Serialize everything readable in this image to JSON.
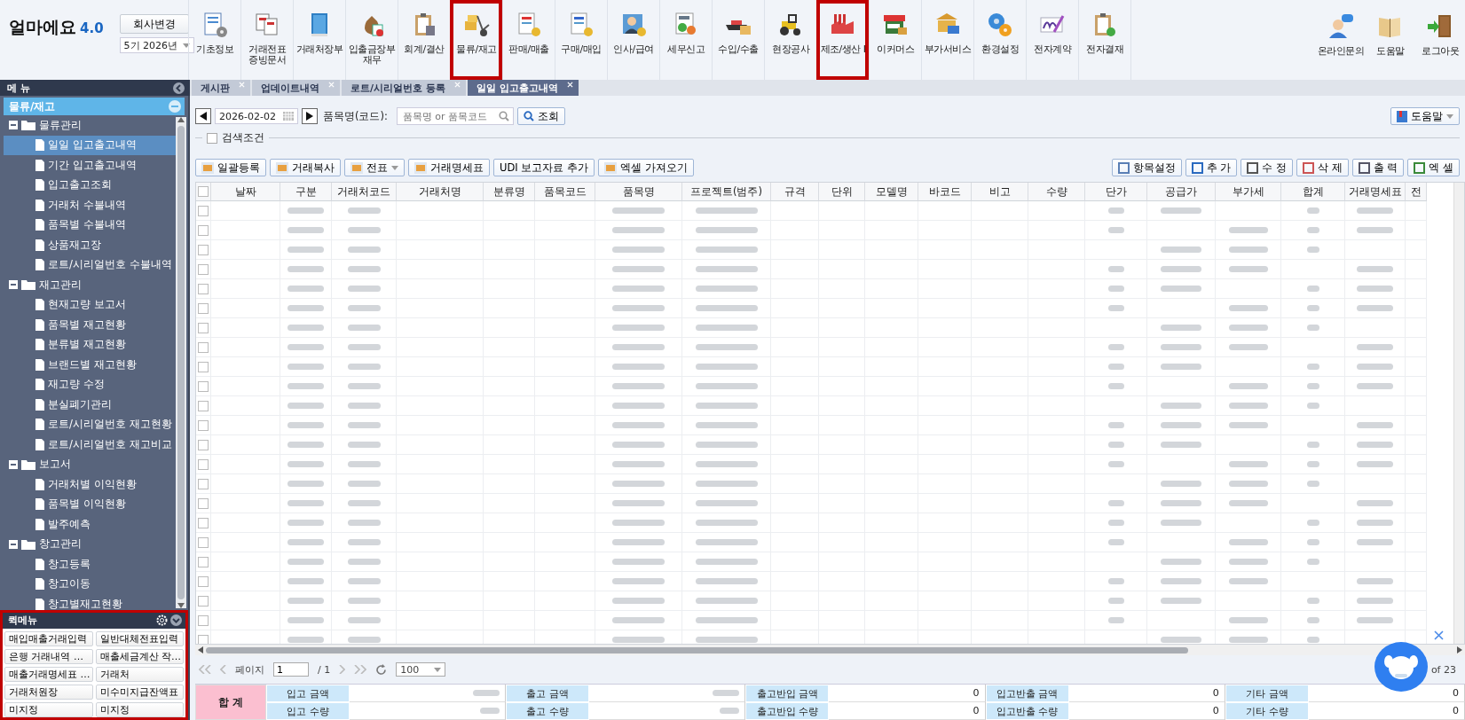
{
  "app": {
    "logo": "얼마에요",
    "version": "4.0",
    "company_button": "회사변경",
    "period": "5기 2026년"
  },
  "toolbar": [
    {
      "label": "기초정보",
      "highlighted": false
    },
    {
      "label": "거래전표\n증빙문서",
      "highlighted": false
    },
    {
      "label": "거래처장부",
      "highlighted": false
    },
    {
      "label": "입출금장부\n재무",
      "highlighted": false
    },
    {
      "label": "회계/결산",
      "highlighted": false
    },
    {
      "label": "물류/재고",
      "highlighted": true
    },
    {
      "label": "판매/매출",
      "highlighted": false
    },
    {
      "label": "구매/매입",
      "highlighted": false
    },
    {
      "label": "인사/급여",
      "highlighted": false
    },
    {
      "label": "세무신고",
      "highlighted": false
    },
    {
      "label": "수입/수출",
      "highlighted": false
    },
    {
      "label": "현장공사",
      "highlighted": false
    },
    {
      "label": "제조/생산 I",
      "highlighted": true
    },
    {
      "label": "이커머스",
      "highlighted": false
    },
    {
      "label": "부가서비스",
      "highlighted": false
    },
    {
      "label": "환경설정",
      "highlighted": false
    },
    {
      "label": "전자계약",
      "highlighted": false
    },
    {
      "label": "전자결재",
      "highlighted": false
    }
  ],
  "toolbar_right": [
    {
      "label": "온라인문의"
    },
    {
      "label": "도움말"
    },
    {
      "label": "로그아웃"
    }
  ],
  "menu_header": "메 뉴",
  "tabs": [
    {
      "label": "게시판",
      "selected": false
    },
    {
      "label": "업데이트내역",
      "selected": false
    },
    {
      "label": "로트/시리얼번호 등록",
      "selected": false
    },
    {
      "label": "일일 입고출고내역",
      "selected": true
    }
  ],
  "sidebar": {
    "section": "물류/재고",
    "tree": [
      {
        "label": "물류관리",
        "expanded": true,
        "children": [
          {
            "label": "일일 입고출고내역",
            "selected": true
          },
          {
            "label": "기간 입고출고내역",
            "selected": false
          },
          {
            "label": "입고출고조회",
            "selected": false
          },
          {
            "label": "거래처 수불내역",
            "selected": false
          },
          {
            "label": "품목별 수불내역",
            "selected": false
          },
          {
            "label": "상품재고장",
            "selected": false
          },
          {
            "label": "로트/시리얼번호 수불내역",
            "selected": false
          }
        ]
      },
      {
        "label": "재고관리",
        "expanded": true,
        "children": [
          {
            "label": "현재고량 보고서",
            "selected": false
          },
          {
            "label": "품목별 재고현황",
            "selected": false
          },
          {
            "label": "분류별 재고현황",
            "selected": false
          },
          {
            "label": "브랜드별 재고현황",
            "selected": false
          },
          {
            "label": "재고량 수정",
            "selected": false
          },
          {
            "label": "분실폐기관리",
            "selected": false
          },
          {
            "label": "로트/시리얼번호 재고현황",
            "selected": false
          },
          {
            "label": "로트/시리얼번호 재고비교",
            "selected": false
          }
        ]
      },
      {
        "label": "보고서",
        "expanded": true,
        "children": [
          {
            "label": "거래처별 이익현황",
            "selected": false
          },
          {
            "label": "품목별 이익현황",
            "selected": false
          },
          {
            "label": "발주예측",
            "selected": false
          }
        ]
      },
      {
        "label": "창고관리",
        "expanded": true,
        "children": [
          {
            "label": "창고등록",
            "selected": false
          },
          {
            "label": "창고이동",
            "selected": false
          },
          {
            "label": "창고별재고현황",
            "selected": false
          }
        ]
      }
    ]
  },
  "quick_menu": {
    "title": "퀵메뉴",
    "highlighted": true,
    "items": [
      "매입매출거래입력",
      "일반대체전표입력",
      "은행 거래내역 …",
      "매출세금계산 작…",
      "매출거래명세표 …",
      "거래처",
      "거래처원장",
      "미수미지급잔액표",
      "미지정",
      "미지정"
    ]
  },
  "search": {
    "date": "2026-02-02",
    "field_label": "품목명(코드):",
    "placeholder": "품목명 or 품목코드",
    "search_button": "조회",
    "help_button": "도움말",
    "condition_label": "검색조건",
    "condition_checked": false
  },
  "actions_left": [
    {
      "label": "일괄등록",
      "kind": "button"
    },
    {
      "label": "거래복사",
      "kind": "button"
    },
    {
      "label": "전표",
      "kind": "dropdown"
    },
    {
      "label": "거래명세표",
      "kind": "button"
    },
    {
      "label": "UDI 보고자료 추가",
      "kind": "plain"
    },
    {
      "label": "엑셀 가져오기",
      "kind": "button"
    }
  ],
  "actions_right": [
    "항목설정",
    "추 가",
    "수 정",
    "삭 제",
    "출 력",
    "엑 셀"
  ],
  "table": {
    "rows": [
      {
        "checked": false
      },
      {
        "checked": false
      },
      {
        "checked": false
      },
      {
        "checked": false
      },
      {
        "checked": false
      },
      {
        "checked": false
      },
      {
        "checked": false
      },
      {
        "checked": false
      },
      {
        "checked": false
      },
      {
        "checked": false
      },
      {
        "checked": false
      },
      {
        "checked": false
      },
      {
        "checked": false
      },
      {
        "checked": false
      },
      {
        "checked": false
      },
      {
        "checked": false
      },
      {
        "checked": false
      },
      {
        "checked": false
      },
      {
        "checked": false
      },
      {
        "checked": false
      },
      {
        "checked": false
      },
      {
        "checked": false
      },
      {
        "checked": false
      }
    ],
    "all_checked": false,
    "columns": [
      "날짜",
      "구분",
      "거래처코드",
      "거래처명",
      "분류명",
      "품목코드",
      "품목명",
      "프로젝트(범주)",
      "규격",
      "단위",
      "모델명",
      "바코드",
      "비고",
      "수량",
      "단가",
      "공급가",
      "부가세",
      "합계",
      "거래명세표",
      "전"
    ]
  },
  "pager": {
    "page_label": "페이지",
    "page": "1",
    "total_pages": "/ 1",
    "page_size": "100",
    "record_info": "of 23"
  },
  "summary": {
    "title": "합 계",
    "rows": [
      [
        {
          "label": "입고 금액",
          "blurred": true
        },
        {
          "label": "출고 금액",
          "blurred": true
        },
        {
          "label": "출고반입 금액",
          "value": "0",
          "blurred": false
        },
        {
          "label": "입고반출 금액",
          "value": "0",
          "blurred": false
        },
        {
          "label": "기타 금액",
          "value": "0",
          "blurred": false
        }
      ],
      [
        {
          "label": "입고 수량",
          "blurred": true
        },
        {
          "label": "출고 수량",
          "blurred": true
        },
        {
          "label": "출고반입 수량",
          "value": "0",
          "blurred": false
        },
        {
          "label": "입고반출 수량",
          "value": "0",
          "blurred": false
        },
        {
          "label": "기타 수량",
          "value": "0",
          "blurred": false
        }
      ]
    ]
  }
}
